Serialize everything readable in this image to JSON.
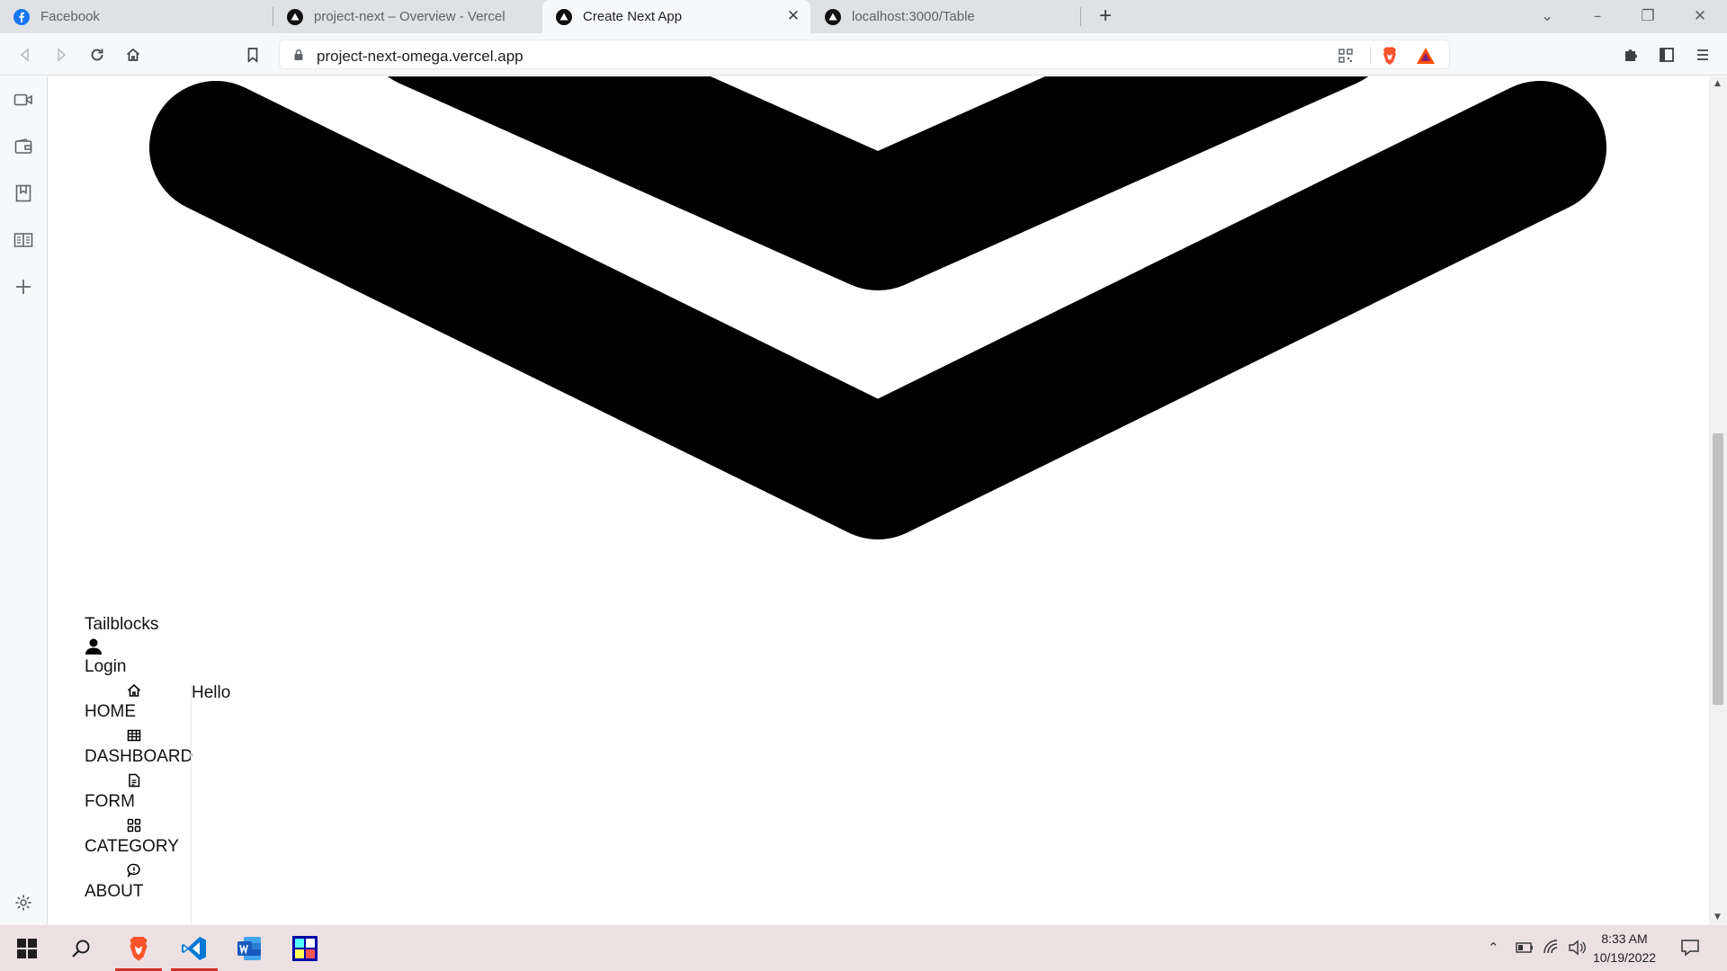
{
  "browser": {
    "tabs": [
      {
        "title": "Facebook",
        "icon": "facebook-icon",
        "active": false
      },
      {
        "title": "project-next – Overview - Vercel",
        "icon": "vercel-icon",
        "active": false
      },
      {
        "title": "Create Next App",
        "icon": "vercel-icon",
        "active": true
      },
      {
        "title": "localhost:3000/Table",
        "icon": "vercel-icon",
        "active": false
      }
    ],
    "address": "project-next-omega.vercel.app"
  },
  "page": {
    "brand": "Tailblocks",
    "login": "Login",
    "nav": [
      {
        "label": "HOME",
        "icon": "home-icon"
      },
      {
        "label": "DASHBOARD",
        "icon": "table-icon"
      },
      {
        "label": "FORM",
        "icon": "document-icon"
      },
      {
        "label": "CATEGORY",
        "icon": "grid-icon"
      },
      {
        "label": "ABOUT",
        "icon": "chat-icon"
      }
    ],
    "content_text": "Hello"
  },
  "taskbar": {
    "time": "8:33 AM",
    "date": "10/19/2022"
  },
  "colors": {
    "accent_brave": "#fb542b",
    "tab_bar": "#dfe1e5",
    "taskbar": "#ece0e3"
  }
}
